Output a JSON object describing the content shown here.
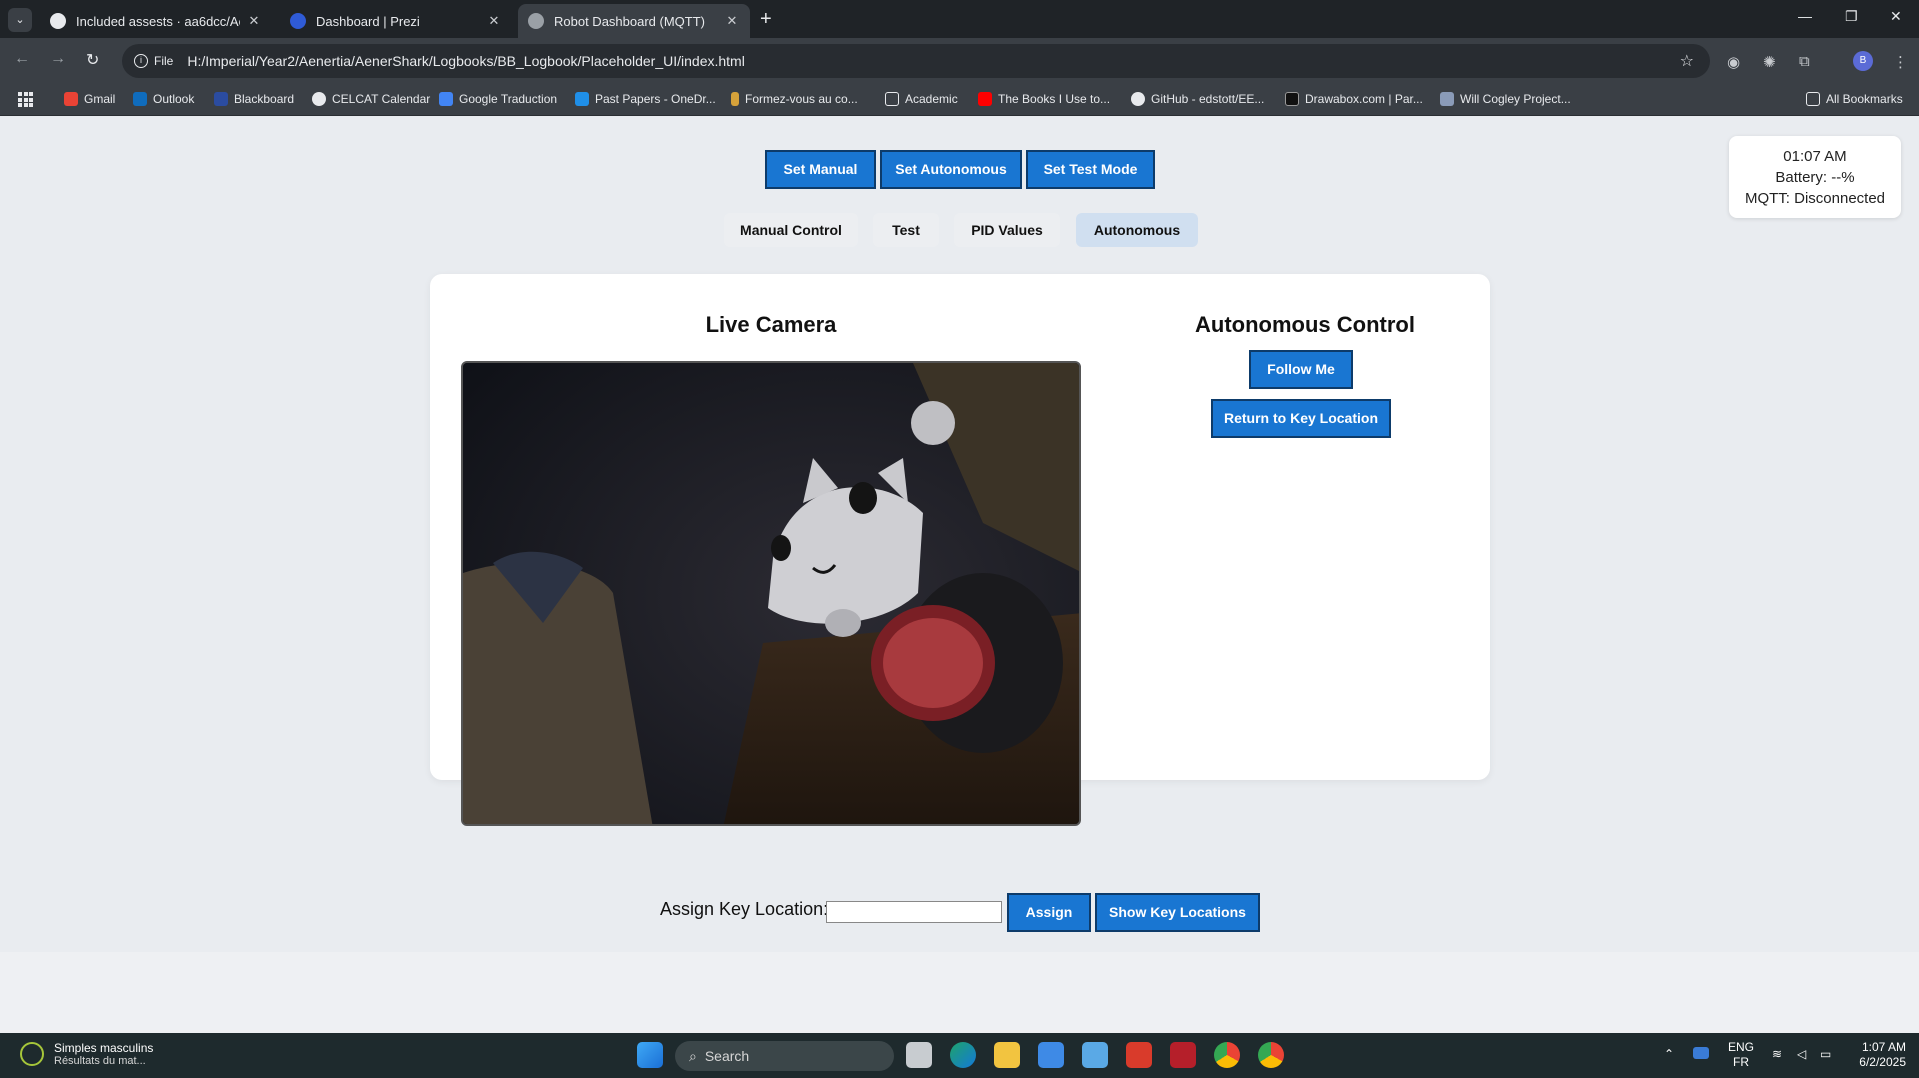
{
  "browser": {
    "tabs": [
      {
        "title": "Included assests · aa6dcc/Aene",
        "close": "✕"
      },
      {
        "title": "Dashboard | Prezi",
        "close": "✕"
      },
      {
        "title": "Robot Dashboard (MQTT)",
        "close": "✕"
      }
    ],
    "new_tab": "+",
    "url_scheme_label": "File",
    "url": "H:/Imperial/Year2/Aenertia/AenerShark/Logbooks/BB_Logbook/Placeholder_UI/index.html",
    "profile_initial": "B",
    "bookmarks": [
      "Gmail",
      "Outlook",
      "Blackboard",
      "CELCAT Calendar",
      "Google Traduction",
      "Past Papers - OneDr...",
      "Formez-vous au co...",
      "Academic",
      "The Books I Use to...",
      "GitHub - edstott/EE...",
      "Drawabox.com | Par...",
      "Will Cogley Project..."
    ],
    "all_bookmarks": "All Bookmarks"
  },
  "status": {
    "time": "01:07 AM",
    "battery": "Battery: --%",
    "mqtt": "MQTT: Disconnected"
  },
  "mode_buttons": {
    "manual": "Set Manual",
    "autonomous": "Set Autonomous",
    "test": "Set Test Mode"
  },
  "tabs": {
    "manual": "Manual Control",
    "test": "Test",
    "pid": "PID Values",
    "autonomous": "Autonomous",
    "selected": "Autonomous"
  },
  "camera": {
    "title": "Live Camera"
  },
  "autonomous": {
    "title": "Autonomous Control",
    "follow_me": "Follow Me",
    "return_key": "Return to Key Location"
  },
  "key_location": {
    "label": "Assign Key Location:",
    "input_value": "",
    "assign": "Assign",
    "show": "Show Key Locations"
  },
  "taskbar": {
    "weather_title": "Simples masculins",
    "weather_sub": "Résultats du mat...",
    "search": "Search",
    "lang_1": "ENG",
    "lang_2": "FR",
    "clock_time": "1:07 AM",
    "clock_date": "6/2/2025"
  }
}
